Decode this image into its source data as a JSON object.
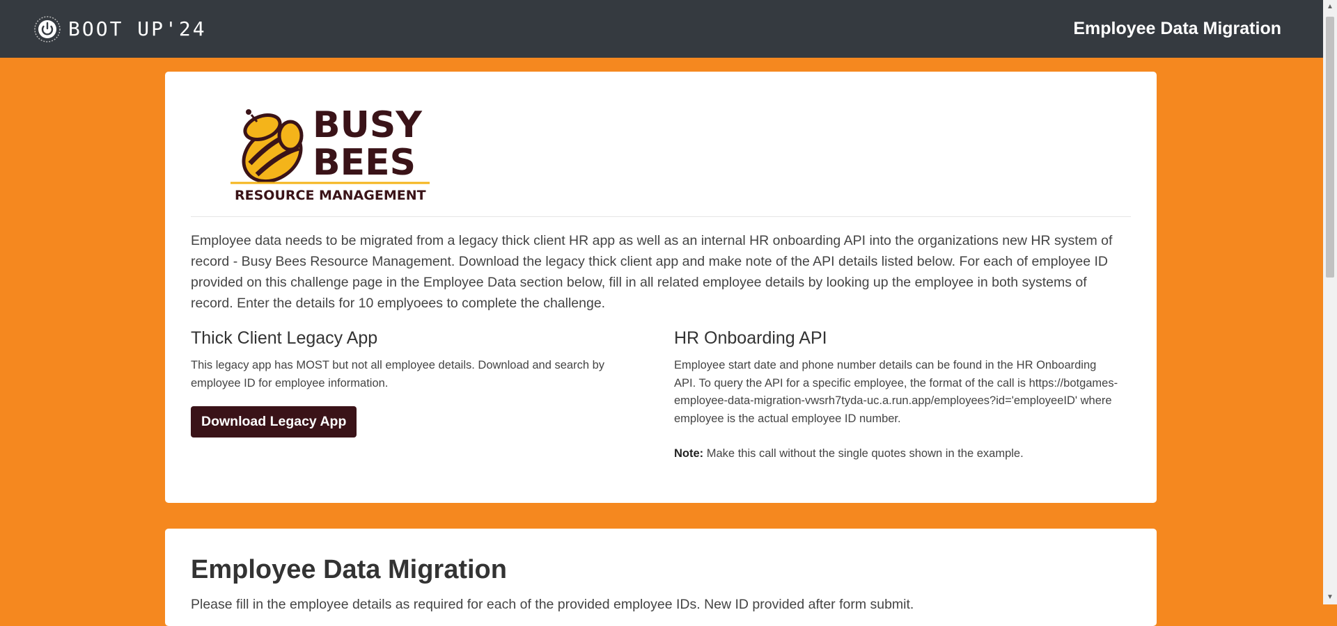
{
  "header": {
    "brand_text": "BOOT UP'24",
    "title": "Employee Data Migration"
  },
  "logo": {
    "line1": "BUSY",
    "line2": "BEES",
    "line3": "RESOURCE MANAGEMENT"
  },
  "intro": "Employee data needs to be migrated from a legacy thick client HR app as well as an internal HR onboarding API into the organizations new HR system of record - Busy Bees Resource Management. Download the legacy thick client app and make note of the API details listed below. For each of employee ID provided on this challenge page in the Employee Data section below, fill in all related employee details by looking up the employee in both systems of record. Enter the details for 10 emplyoees to complete the challenge.",
  "legacy": {
    "heading": "Thick Client Legacy App",
    "text": "This legacy app has MOST but not all employee details. Download and search by employee ID for employee information.",
    "button_label": "Download Legacy App"
  },
  "api": {
    "heading": "HR Onboarding API",
    "text": "Employee start date and phone number details can be found in the HR Onboarding API. To query the API for a specific employee, the format of the call is https://botgames-employee-data-migration-vwsrh7tyda-uc.a.run.app/employees?id='employeeID' where employee is the actual employee ID number.",
    "note_label": "Note:",
    "note_text": " Make this call without the single quotes shown in the example."
  },
  "migration": {
    "heading": "Employee Data Migration",
    "subtext": "Please fill in the employee details as required for each of the provided employee IDs. New ID provided after form submit."
  },
  "colors": {
    "background": "#f5881f",
    "topbar": "#353a40",
    "button": "#3a1318",
    "logo_text": "#3a1318",
    "bee_yellow": "#f4b41a"
  }
}
